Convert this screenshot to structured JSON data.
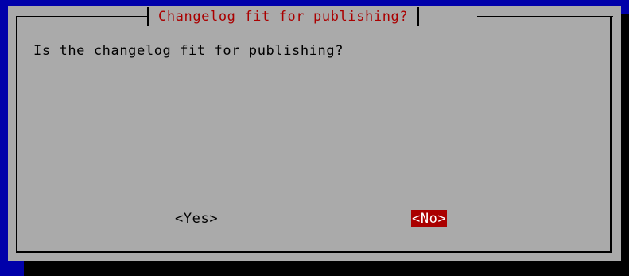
{
  "dialog": {
    "title": "Changelog fit for publishing?",
    "message": "Is the changelog fit for publishing?",
    "buttons": {
      "yes_label": "<Yes>",
      "no_label": "<No>"
    },
    "selected_button": "No"
  },
  "colors": {
    "background": "#0000aa",
    "dialog_bg": "#aaaaaa",
    "accent": "#aa0000",
    "text": "#000000",
    "selected_text": "#ffffff"
  }
}
